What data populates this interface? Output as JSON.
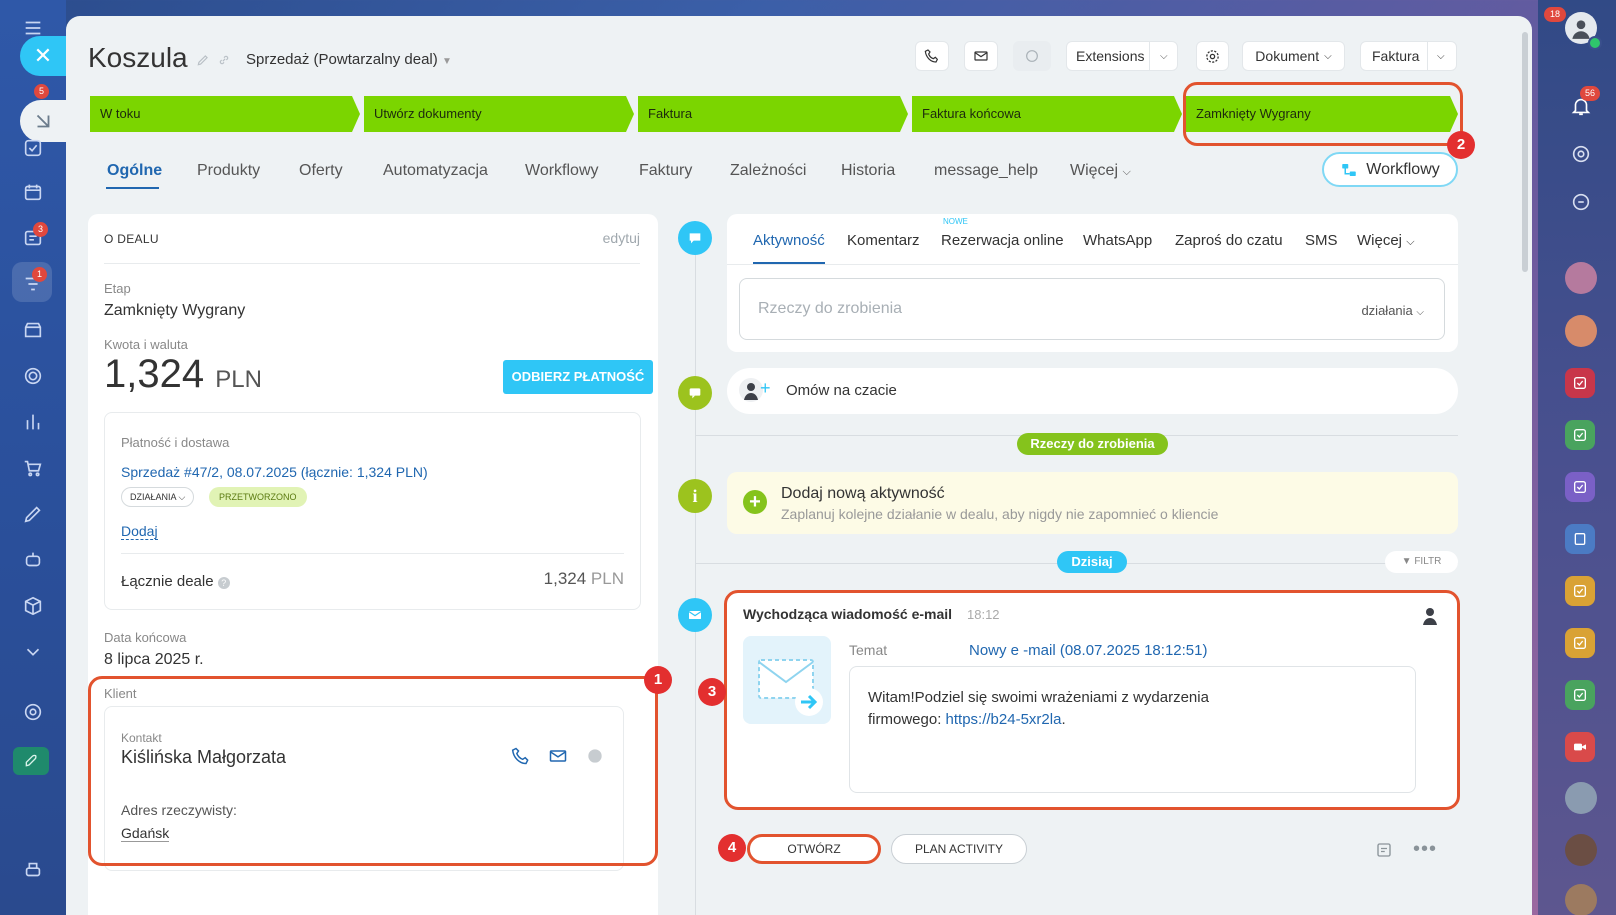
{
  "deal": {
    "title": "Koszula",
    "pipeline": "Sprzedaż (Powtarzalny deal)"
  },
  "toolbar": {
    "extensions": "Extensions",
    "document": "Dokument",
    "invoice": "Faktura"
  },
  "stages": [
    "W toku",
    "Utwórz dokumenty",
    "Faktura",
    "Faktura końcowa",
    "Zamknięty Wygrany"
  ],
  "tabs": [
    "Ogólne",
    "Produkty",
    "Oferty",
    "Automatyzacja",
    "Workflowy",
    "Faktury",
    "Zależności",
    "Historia",
    "message_help",
    "Więcej"
  ],
  "workflow_btn": "Workflowy",
  "about": {
    "header": "O DEALU",
    "edit": "edytuj",
    "stage_label": "Etap",
    "stage_value": "Zamknięty Wygrany",
    "amount_label": "Kwota i waluta",
    "amount": "1,324",
    "currency": "PLN",
    "pay_btn": "ODBIERZ PŁATNOŚĆ",
    "payment_label": "Płatność i dostawa",
    "payment_link": "Sprzedaż #47/2, 08.07.2025 (łącznie: 1,324 PLN)",
    "actions_tag": "DZIAŁANIA",
    "processed_tag": "PRZETWORZONO",
    "add": "Dodaj",
    "total_label": "Łącznie deale",
    "total_amount": "1,324",
    "total_currency": "PLN",
    "end_date_label": "Data końcowa",
    "end_date": "8 lipca 2025 r.",
    "client_label": "Klient",
    "contact_label": "Kontakt",
    "contact_name": "Kiślińska Małgorzata",
    "address_label": "Adres rzeczywisty:",
    "address": "Gdańsk"
  },
  "activity": {
    "tabs": [
      "Aktywność",
      "Komentarz",
      "Rezerwacja online",
      "WhatsApp",
      "Zaproś do czatu",
      "SMS",
      "Więcej"
    ],
    "new_badge": "NOWE",
    "todo_placeholder": "Rzeczy do zrobienia",
    "actions": "działania",
    "chat": "Omów na czacie",
    "todo_pill": "Rzeczy do zrobienia",
    "add_title": "Dodaj nową aktywność",
    "add_desc": "Zaplanuj kolejne działanie w dealu, aby nigdy nie zapomnieć o kliencie",
    "today_pill": "Dzisiaj",
    "filter": "FILTR",
    "email_title": "Wychodząca wiadomość e-mail",
    "email_time": "18:12",
    "subject_label": "Temat",
    "subject": "Nowy e -mail (08.07.2025 18:12:51)",
    "body_line1": "Witam!Podziel się swoimi wrażeniami z wydarzenia",
    "body_line2": "firmowego: ",
    "body_link": "https://b24-5xr2la",
    "open_btn": "OTWÓRZ",
    "plan_btn": "PLAN ACTIVITY"
  },
  "badges": [
    "1",
    "2",
    "3",
    "4"
  ],
  "left_counts": [
    "5",
    "3",
    "1"
  ],
  "right_counts": [
    "56",
    "18"
  ],
  "colors": {
    "accent": "#2fc6f6",
    "stage_green": "#7bd500",
    "annotation": "#e2532e",
    "badge": "#e32f2f",
    "link": "#2067b0"
  }
}
